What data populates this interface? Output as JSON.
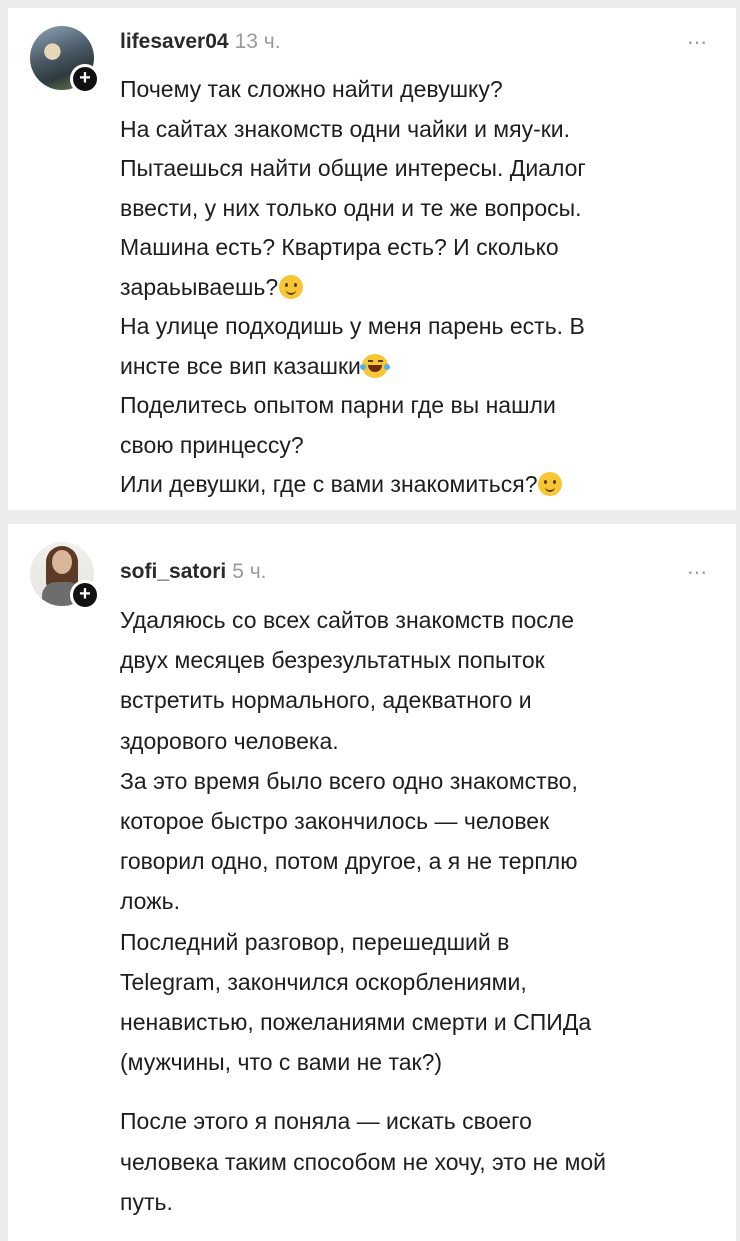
{
  "colors": {
    "page_background": "#ececec",
    "card_background": "#ffffff",
    "meta_gray": "#9a9a9a",
    "text": "#1e1e1e"
  },
  "posts": [
    {
      "username": "lifesaver04",
      "time": "13 ч.",
      "more": "⋯",
      "avatar_icon": "user-avatar-photo",
      "lines": [
        {
          "text": "Почему так сложно найти девушку?"
        },
        {
          "text": "На сайтах знакомств одни чайки и мяу-ки."
        },
        {
          "text": "Пытаешься найти общие интересы. Диалог"
        },
        {
          "text": "ввести, у них только одни и те же вопросы."
        },
        {
          "text": "Машина есть? Квартира есть? И сколько"
        },
        {
          "text": "зараьываешь?",
          "emoji": "slightly-smiling-face-icon"
        },
        {
          "text": "На улице подходишь у меня парень есть. В"
        },
        {
          "text": "инсте все вип казашки",
          "emoji": "tears-of-joy-icon"
        },
        {
          "text": "Поделитесь опытом парни где вы нашли"
        },
        {
          "text": "свою принцессу?"
        },
        {
          "text": "Или девушки, где с вами знакомиться?",
          "emoji": "slightly-smiling-face-icon"
        }
      ]
    },
    {
      "username": "sofi_satori",
      "time": "5 ч.",
      "more": "⋯",
      "avatar_icon": "user-avatar-photo",
      "lines": [
        {
          "text": "Удаляюсь со всех сайтов знакомств после"
        },
        {
          "text": "двух месяцев безрезультатных попыток"
        },
        {
          "text": "встретить нормального, адекватного и"
        },
        {
          "text": "здорового человека."
        },
        {
          "text": "За это время было всего одно знакомство,"
        },
        {
          "text": "которое быстро закончилось — человек"
        },
        {
          "text": "говорил одно, потом другое, а я не терплю"
        },
        {
          "text": "ложь."
        },
        {
          "text": "Последний разговор, перешедший в"
        },
        {
          "text": "Telegram, закончился оскорблениями,"
        },
        {
          "text": "ненавистью, пожеланиями смерти и СПИДа"
        },
        {
          "text": "(мужчины, что с вами не так?)"
        },
        {
          "gap": true
        },
        {
          "text": "После этого я поняла — искать своего"
        },
        {
          "text": "человека таким способом не хочу, это не мой"
        },
        {
          "text": "путь."
        }
      ]
    }
  ]
}
